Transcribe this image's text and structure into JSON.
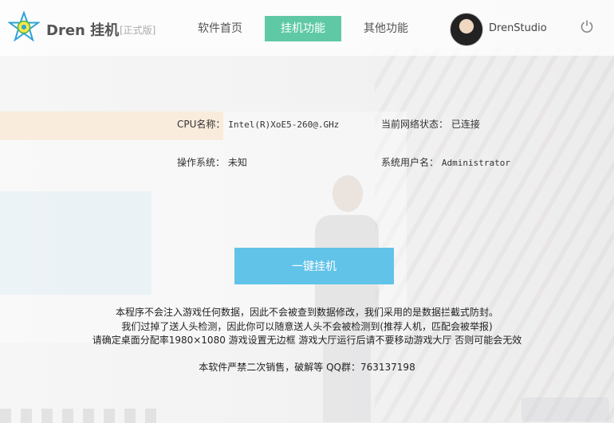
{
  "header": {
    "brand": "Dren 挂机",
    "edition": "[正式版]",
    "tabs": [
      {
        "label": "软件首页",
        "active": false
      },
      {
        "label": "挂机功能",
        "active": true
      },
      {
        "label": "其他功能",
        "active": false
      }
    ],
    "user": {
      "name": "DrenStudio"
    }
  },
  "info": {
    "cpu_label": "CPU名称：",
    "cpu_value": "Intel(R)XoE5-260@.GHz",
    "network_label": "当前网络状态：",
    "network_value": "已连接",
    "os_label": "操作系统：",
    "os_value": "未知",
    "sysuser_label": "系统用户名：",
    "sysuser_value": "Administrator"
  },
  "action": {
    "one_key_label": "一键挂机"
  },
  "notices": [
    "本程序不会注入游戏任何数据，因此不会被查到数据修改，我们采用的是数据拦截式防封。",
    "我们过掉了送人头检测，因此你可以随意送人头不会被检测到(推荐人机，匹配会被举报)",
    "请确定桌面分配率1980×1080   游戏设置无边框   游戏大厅运行后请不要移动游戏大厅  否则可能会无效",
    "本软件严禁二次销售，破解等   QQ群：763137198"
  ],
  "colors": {
    "accent_green": "#5fc9a6",
    "button_blue": "#62c3e9",
    "logo_blue": "#2ea3d6"
  },
  "icons": {
    "logo": "star-logo-icon",
    "logout": "power-icon"
  }
}
